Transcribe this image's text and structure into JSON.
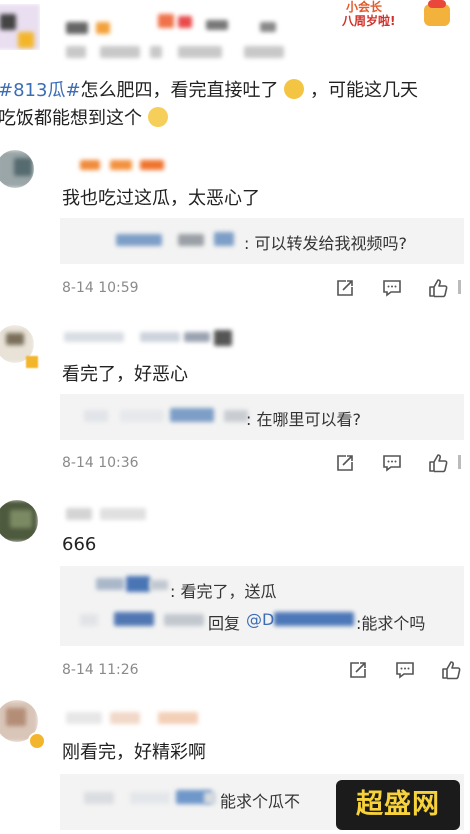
{
  "post": {
    "hashtag": "#813瓜#",
    "line1_rest": "怎么肥四，看完直接吐了",
    "line1_tail": "，可能这几天",
    "line2": "吃饭都能想到这个",
    "badge_line1": "小会长",
    "badge_line2": "八周岁啦!"
  },
  "comments": [
    {
      "text": "我也吃过这瓜，太恶心了",
      "replies": [
        {
          "text": ": 可以转发给我视频吗?"
        }
      ],
      "time": "8-14 10:59"
    },
    {
      "text": "看完了，好恶心",
      "replies": [
        {
          "text": ": 在哪里可以看?"
        }
      ],
      "time": "8-14 10:36"
    },
    {
      "text": "666",
      "replies": [
        {
          "text": ": 看完了，送瓜"
        },
        {
          "reply_word": "回复",
          "mention": "@D",
          "text": ":能求个吗"
        }
      ],
      "time": "8-14 11:26"
    },
    {
      "text": "刚看完，好精彩啊",
      "replies": [
        {
          "text": "能求个瓜不"
        }
      ],
      "time": ""
    }
  ],
  "watermark": "超盛网",
  "icons": [
    "share-icon",
    "comment-icon",
    "like-icon"
  ],
  "colors": {
    "link": "#3b6db5",
    "reply_bg": "#f3f3f3",
    "time": "#8a8a8a"
  }
}
